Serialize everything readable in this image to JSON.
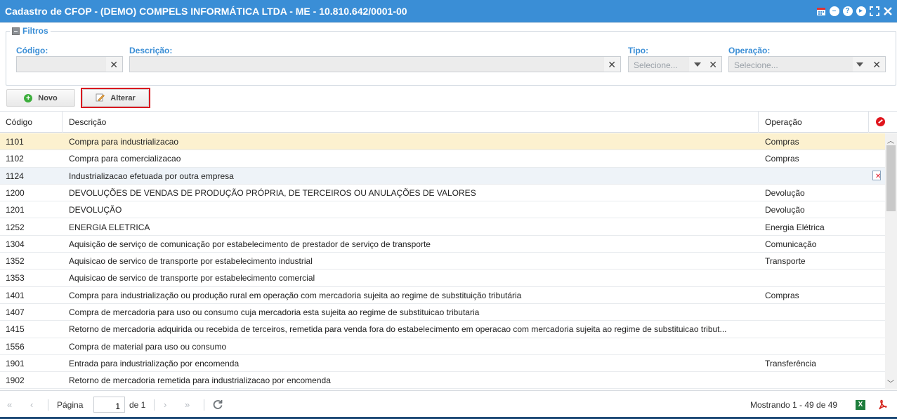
{
  "window": {
    "title": "Cadastro de CFOP - (DEMO) COMPELS INFORMÁTICA LTDA - ME - 10.810.642/0001-00"
  },
  "filters": {
    "legend": "Filtros",
    "codigo": {
      "label": "Código:",
      "value": ""
    },
    "descricao": {
      "label": "Descrição:",
      "value": ""
    },
    "tipo": {
      "label": "Tipo:",
      "placeholder": "Selecione..."
    },
    "operacao": {
      "label": "Operação:",
      "placeholder": "Selecione..."
    }
  },
  "toolbar": {
    "novo_label": "Novo",
    "alterar_label": "Alterar"
  },
  "grid": {
    "columns": [
      "Código",
      "Descrição",
      "Operação"
    ],
    "rows": [
      {
        "codigo": "1101",
        "descricao": "Compra para industrializacao",
        "operacao": "Compras"
      },
      {
        "codigo": "1102",
        "descricao": "Compra para comercializacao",
        "operacao": "Compras"
      },
      {
        "codigo": "1124",
        "descricao": "Industrializacao efetuada por outra empresa",
        "operacao": ""
      },
      {
        "codigo": "1200",
        "descricao": "DEVOLUÇÕES DE VENDAS DE PRODUÇÃO PRÓPRIA, DE TERCEIROS OU ANULAÇÕES DE VALORES",
        "operacao": "Devolução"
      },
      {
        "codigo": "1201",
        "descricao": "DEVOLUÇÃO",
        "operacao": "Devolução"
      },
      {
        "codigo": "1252",
        "descricao": "ENERGIA ELETRICA",
        "operacao": "Energia Elétrica"
      },
      {
        "codigo": "1304",
        "descricao": "Aquisição de serviço de comunicação por estabelecimento de prestador de serviço de transporte",
        "operacao": "Comunicação"
      },
      {
        "codigo": "1352",
        "descricao": "Aquisicao de servico de transporte por estabelecimento industrial",
        "operacao": "Transporte"
      },
      {
        "codigo": "1353",
        "descricao": "Aquisicao de servico de transporte por estabelecimento comercial",
        "operacao": ""
      },
      {
        "codigo": "1401",
        "descricao": "Compra para industrialização ou produção rural em operação com mercadoria sujeita ao regime de substituição tributária",
        "operacao": "Compras"
      },
      {
        "codigo": "1407",
        "descricao": "Compra de mercadoria para uso ou consumo cuja mercadoria esta sujeita ao regime de substituicao tributaria",
        "operacao": ""
      },
      {
        "codigo": "1415",
        "descricao": "Retorno de mercadoria adquirida ou recebida de terceiros, remetida para venda fora do estabelecimento em operacao com mercadoria sujeita ao regime de substituicao tribut...",
        "operacao": ""
      },
      {
        "codigo": "1556",
        "descricao": "Compra de material para uso ou consumo",
        "operacao": ""
      },
      {
        "codigo": "1901",
        "descricao": "Entrada para industrialização por encomenda",
        "operacao": "Transferência"
      },
      {
        "codigo": "1902",
        "descricao": "Retorno de mercadoria remetida para industrializacao por encomenda",
        "operacao": ""
      }
    ]
  },
  "pager": {
    "page_label": "Página",
    "page_value": "1",
    "of_label": "de 1",
    "status": "Mostrando 1 - 49 de 49"
  }
}
